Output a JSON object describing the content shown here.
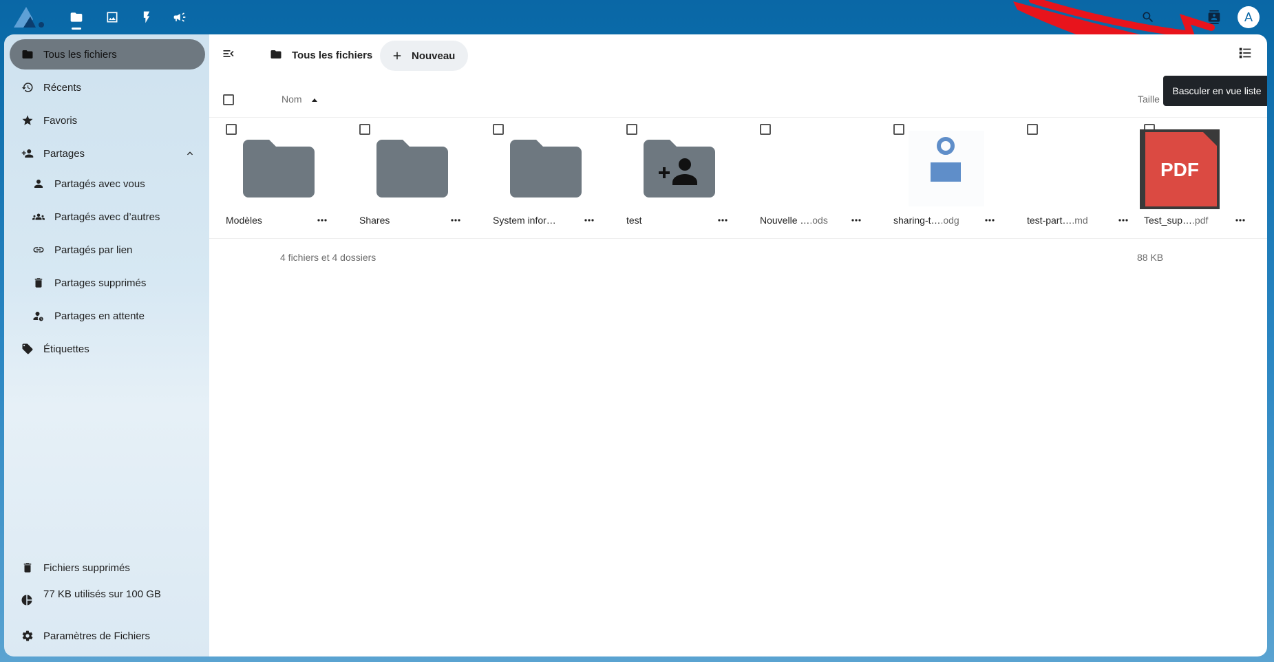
{
  "topbar": {
    "apps": [
      {
        "name": "files-app-icon"
      },
      {
        "name": "photos-app-icon"
      },
      {
        "name": "activity-app-icon"
      },
      {
        "name": "announcements-app-icon"
      }
    ],
    "avatar_letter": "A"
  },
  "sidebar": {
    "items": [
      {
        "label": "Tous les fichiers",
        "icon": "folder-icon",
        "active": true
      },
      {
        "label": "Récents",
        "icon": "history-icon"
      },
      {
        "label": "Favoris",
        "icon": "star-icon"
      },
      {
        "label": "Partages",
        "icon": "share-icon",
        "expanded": true
      },
      {
        "label": "Partagés avec vous",
        "icon": "user-icon"
      },
      {
        "label": "Partagés avec d’autres",
        "icon": "users-icon"
      },
      {
        "label": "Partagés par lien",
        "icon": "link-icon"
      },
      {
        "label": "Partages supprimés",
        "icon": "trash-icon"
      },
      {
        "label": "Partages en attente",
        "icon": "user-clock-icon"
      },
      {
        "label": "Étiquettes",
        "icon": "tags-icon"
      }
    ],
    "footer": {
      "deleted": "Fichiers supprimés",
      "quota": "77 KB utilisés sur 100 GB",
      "settings": "Paramètres de Fichiers"
    }
  },
  "main": {
    "breadcrumb": "Tous les fichiers",
    "new_button": "Nouveau",
    "tooltip": "Basculer en vue liste",
    "columns": {
      "name": "Nom",
      "size": "Taille"
    },
    "files": [
      {
        "base": "Modèles",
        "ext": "",
        "kind": "folder"
      },
      {
        "base": "Shares",
        "ext": "",
        "kind": "folder"
      },
      {
        "base": "System infor…",
        "ext": "",
        "kind": "folder"
      },
      {
        "base": "test",
        "ext": "",
        "kind": "shared-folder"
      },
      {
        "base": "Nouvelle …",
        "ext": ".ods",
        "kind": "blank"
      },
      {
        "base": "sharing-t…",
        "ext": ".odg",
        "kind": "drawing"
      },
      {
        "base": "test-part…",
        "ext": ".md",
        "kind": "blank"
      },
      {
        "base": "Test_sup…",
        "ext": ".pdf",
        "kind": "pdf"
      }
    ],
    "pdf_label": "PDF",
    "summary": "4 fichiers et 4 dossiers",
    "summary_size": "88 KB"
  },
  "colors": {
    "brand": "#0a67a6",
    "folder": "#6e7880",
    "pdf": "#db4a42",
    "annotation": "#e8141c"
  }
}
